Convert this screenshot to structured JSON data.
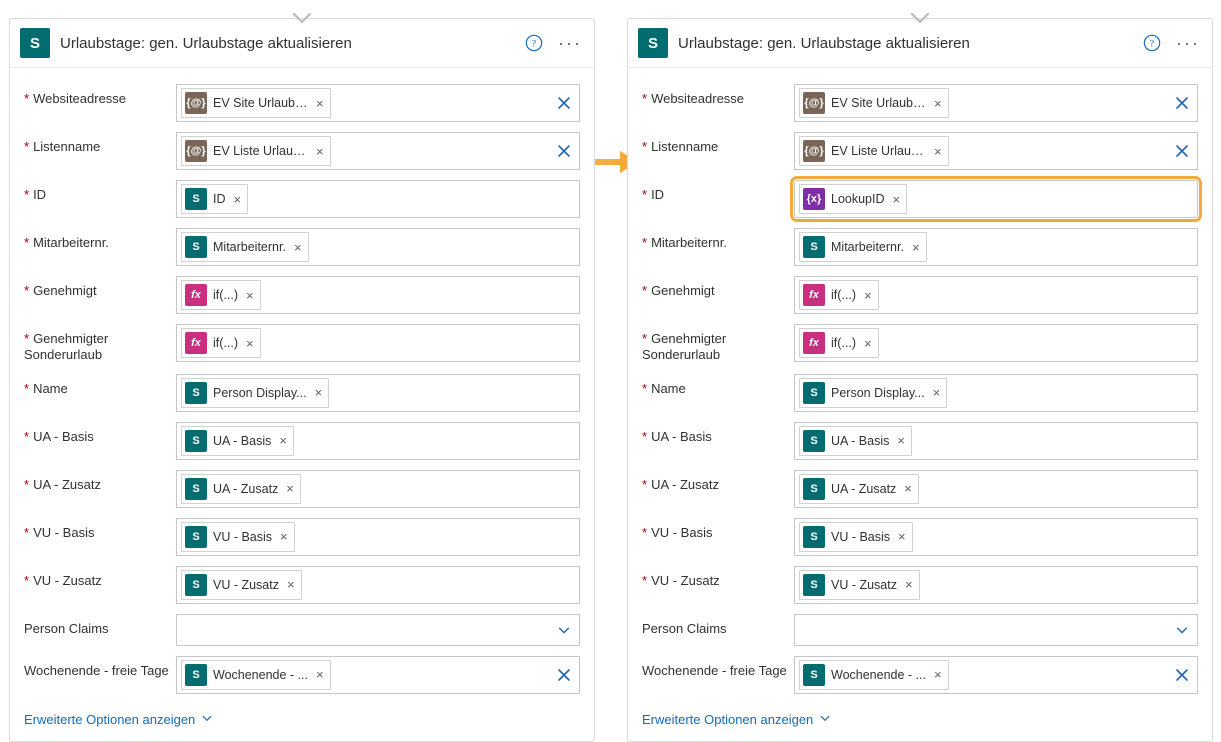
{
  "header_title": "Urlaubstage: gen. Urlaubstage aktualisieren",
  "adv_options_label": "Erweiterte Optionen anzeigen",
  "left": {
    "fields": [
      {
        "label": "Websiteadresse",
        "required": true,
        "token_type": "env",
        "token_text": "EV Site Urlaubs...",
        "trail": "x"
      },
      {
        "label": "Listenname",
        "required": true,
        "token_type": "env",
        "token_text": "EV Liste Urlaub...",
        "trail": "x"
      },
      {
        "label": "ID",
        "required": true,
        "token_type": "sp",
        "token_text": "ID",
        "trail": "none"
      },
      {
        "label": "Mitarbeiternr.",
        "required": true,
        "token_type": "sp",
        "token_text": "Mitarbeiternr.",
        "trail": "none"
      },
      {
        "label": "Genehmigt",
        "required": true,
        "token_type": "fx",
        "token_text": "if(...)",
        "trail": "none"
      },
      {
        "label": "Genehmigter Sonderurlaub",
        "required": true,
        "token_type": "fx",
        "token_text": "if(...)",
        "trail": "none"
      },
      {
        "label": "Name",
        "required": true,
        "token_type": "sp",
        "token_text": "Person Display...",
        "trail": "none"
      },
      {
        "label": "UA - Basis",
        "required": true,
        "token_type": "sp",
        "token_text": "UA - Basis",
        "trail": "none"
      },
      {
        "label": "UA - Zusatz",
        "required": true,
        "token_type": "sp",
        "token_text": "UA - Zusatz",
        "trail": "none"
      },
      {
        "label": "VU - Basis",
        "required": true,
        "token_type": "sp",
        "token_text": "VU - Basis",
        "trail": "none"
      },
      {
        "label": "VU - Zusatz",
        "required": true,
        "token_type": "sp",
        "token_text": "VU - Zusatz",
        "trail": "none"
      },
      {
        "label": "Person Claims",
        "required": false,
        "token_type": "",
        "token_text": "",
        "trail": "chev"
      },
      {
        "label": "Wochenende - freie Tage",
        "required": false,
        "token_type": "sp",
        "token_text": "Wochenende - ...",
        "trail": "x"
      }
    ]
  },
  "right": {
    "fields": [
      {
        "label": "Websiteadresse",
        "required": true,
        "token_type": "env",
        "token_text": "EV Site Urlaubs...",
        "trail": "x"
      },
      {
        "label": "Listenname",
        "required": true,
        "token_type": "env",
        "token_text": "EV Liste Urlaub...",
        "trail": "x"
      },
      {
        "label": "ID",
        "required": true,
        "token_type": "var",
        "token_text": "LookupID",
        "trail": "none",
        "highlight": true
      },
      {
        "label": "Mitarbeiternr.",
        "required": true,
        "token_type": "sp",
        "token_text": "Mitarbeiternr.",
        "trail": "none"
      },
      {
        "label": "Genehmigt",
        "required": true,
        "token_type": "fx",
        "token_text": "if(...)",
        "trail": "none"
      },
      {
        "label": "Genehmigter Sonderurlaub",
        "required": true,
        "token_type": "fx",
        "token_text": "if(...)",
        "trail": "none"
      },
      {
        "label": "Name",
        "required": true,
        "token_type": "sp",
        "token_text": "Person Display...",
        "trail": "none"
      },
      {
        "label": "UA - Basis",
        "required": true,
        "token_type": "sp",
        "token_text": "UA - Basis",
        "trail": "none"
      },
      {
        "label": "UA - Zusatz",
        "required": true,
        "token_type": "sp",
        "token_text": "UA - Zusatz",
        "trail": "none"
      },
      {
        "label": "VU - Basis",
        "required": true,
        "token_type": "sp",
        "token_text": "VU - Basis",
        "trail": "none"
      },
      {
        "label": "VU - Zusatz",
        "required": true,
        "token_type": "sp",
        "token_text": "VU - Zusatz",
        "trail": "none"
      },
      {
        "label": "Person Claims",
        "required": false,
        "token_type": "",
        "token_text": "",
        "trail": "chev"
      },
      {
        "label": "Wochenende - freie Tage",
        "required": false,
        "token_type": "sp",
        "token_text": "Wochenende - ...",
        "trail": "x"
      }
    ]
  },
  "icon_glyphs": {
    "sp": "S",
    "env": "{@}",
    "fx": "fx",
    "var": "{x}"
  }
}
